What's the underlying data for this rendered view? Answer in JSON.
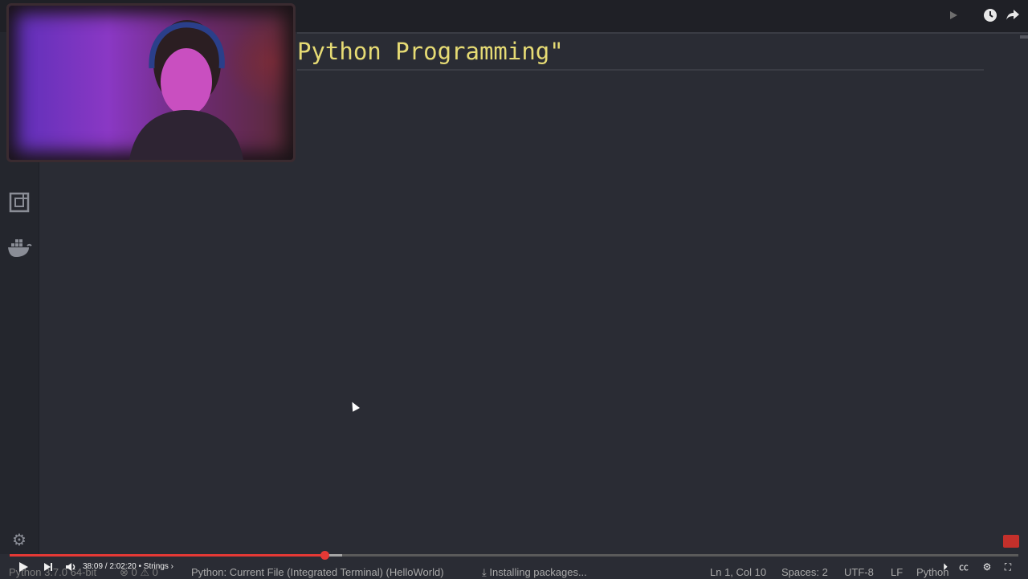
{
  "editor": {
    "code_line": "Python Programming\""
  },
  "player": {
    "time_display": "38:09 / 2:02:20 • Strings ›",
    "progress_percent": 31.2,
    "buffered_percent": 33.0
  },
  "statusbar": {
    "interpreter": "Python 3.7.0 64-bit",
    "errors": "0",
    "warnings": "0",
    "run_config": "Python: Current File (Integrated Terminal) (HelloWorld)",
    "installing": "Installing packages...",
    "cursor_pos": "Ln 1, Col 10",
    "spaces": "Spaces: 2",
    "encoding": "UTF-8",
    "eol": "LF",
    "language": "Python"
  },
  "colors": {
    "string": "#e6db74",
    "progress": "#e53935",
    "background": "#2a2c34"
  }
}
